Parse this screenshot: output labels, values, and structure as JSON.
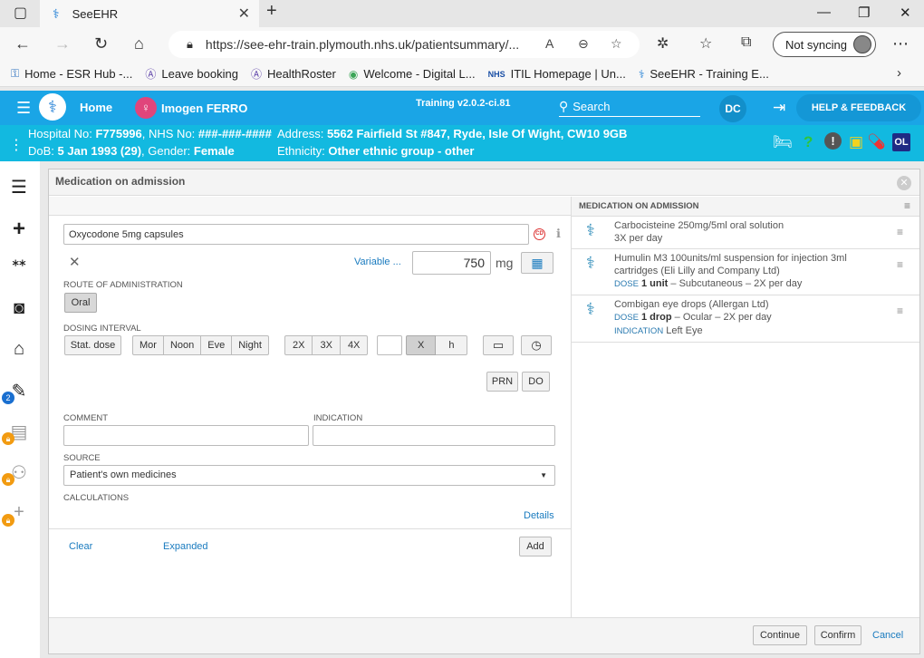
{
  "browser": {
    "tab_title": "SeeEHR",
    "url": "https://see-ehr-train.plymouth.nhs.uk/patientsummary/...",
    "sync_label": "Not syncing",
    "bookmarks": [
      {
        "icon": "key-icon",
        "label": "Home - ESR Hub -..."
      },
      {
        "icon": "a-circle-icon",
        "label": "Leave booking"
      },
      {
        "icon": "a-circle-icon",
        "label": "HealthRoster"
      },
      {
        "icon": "globe-icon",
        "label": "Welcome - Digital L..."
      },
      {
        "icon": "nhs-icon",
        "label": "ITIL Homepage | Un..."
      },
      {
        "icon": "caduceus-icon",
        "label": "SeeEHR - Training E..."
      }
    ]
  },
  "header": {
    "home": "Home",
    "patient_name": "Imogen FERRO",
    "version": "Training v2.0.2-ci.81",
    "search_label": "Search",
    "user_initials": "DC",
    "help": "HELP & FEEDBACK"
  },
  "patient": {
    "hospital_label": "Hospital No:",
    "hospital_no": "F775996",
    "nhs_label": "NHS No:",
    "nhs_no": "###-###-####",
    "dob_label": "DoB:",
    "dob": "5 Jan 1993 (29)",
    "gender_label": "Gender:",
    "gender": "Female",
    "address_label": "Address:",
    "address": "5562 Fairfield St #847, Ryde, Isle Of Wight, CW10 9GB",
    "ethnicity_label": "Ethnicity:",
    "ethnicity": "Other ethnic group - other",
    "badge": "OL"
  },
  "sidebar": {
    "badge_count": "2"
  },
  "modal": {
    "title": "Medication on admission",
    "drug_value": "Oxycodone 5mg capsules",
    "variable_label": "Variable ...",
    "dose_value": "750",
    "dose_unit": "mg",
    "route_label": "ROUTE OF ADMINISTRATION",
    "route_value": "Oral",
    "dosing_label": "DOSING INTERVAL",
    "stat_dose": "Stat. dose",
    "times": [
      "Mor",
      "Noon",
      "Eve",
      "Night"
    ],
    "freq": [
      "2X",
      "3X",
      "4X"
    ],
    "unit_x": "X",
    "unit_h": "h",
    "prn": "PRN",
    "do": "DO",
    "comment_label": "COMMENT",
    "indication_label": "INDICATION",
    "source_label": "SOURCE",
    "source_value": "Patient's own medicines",
    "calc_label": "CALCULATIONS",
    "details": "Details",
    "clear": "Clear",
    "expanded": "Expanded",
    "add": "Add",
    "continue": "Continue",
    "confirm": "Confirm",
    "cancel": "Cancel"
  },
  "med_list": {
    "title": "MEDICATION ON ADMISSION",
    "items": [
      {
        "name": "Carbocisteine 250mg/5ml oral solution",
        "freq": "3X per day"
      },
      {
        "name": "Humulin M3 100units/ml suspension for injection 3ml cartridges (Eli Lilly and Company Ltd)",
        "dose_label": "DOSE",
        "dose": "1 unit",
        "rest": " – Subcutaneous – 2X per day"
      },
      {
        "name": "Combigan eye drops (Allergan Ltd)",
        "dose_label": "DOSE",
        "dose": "1 drop",
        "rest": " – Ocular – 2X per day",
        "indication_label": "INDICATION",
        "indication": "Left Eye"
      }
    ]
  }
}
